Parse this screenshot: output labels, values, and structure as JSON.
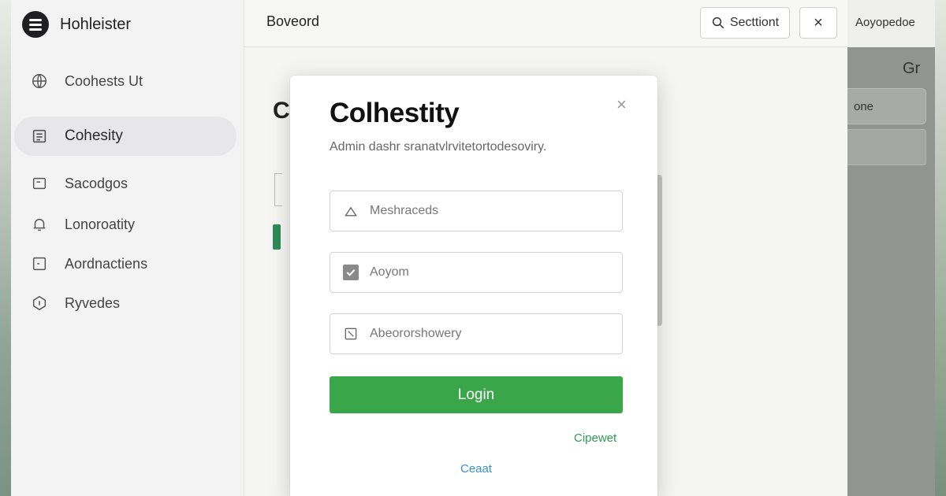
{
  "sidebar": {
    "brand": "Hohleister",
    "items": [
      {
        "label": "Coohests Ut",
        "icon": "globe-icon"
      },
      {
        "label": "Cohesity",
        "icon": "document-icon",
        "active": true
      },
      {
        "label": "Sacodgos",
        "icon": "card-icon"
      },
      {
        "label": "Lonoroatity",
        "icon": "bell-icon"
      },
      {
        "label": "Aordnactiens",
        "icon": "list-icon"
      },
      {
        "label": "Ryvedes",
        "icon": "shield-icon"
      }
    ]
  },
  "header": {
    "title": "Boveord",
    "search_label": "Secttiont",
    "close_label": "×"
  },
  "right_panel": {
    "title": "Aoyopedoe",
    "glyph": "Gr",
    "field_label": "one"
  },
  "background_page": {
    "heading_initial": "C"
  },
  "modal": {
    "title": "Colhestity",
    "subtitle": "Admin dashr sranatvlrvitetortodesoviry.",
    "close_label": "×",
    "fields": [
      {
        "placeholder": "Meshraceds",
        "icon": "user-icon"
      },
      {
        "placeholder": "Aoyom",
        "icon": "checkbox-icon"
      },
      {
        "placeholder": "Abeororshowery",
        "icon": "edit-icon"
      }
    ],
    "login_label": "Login",
    "secondary_link": "Cipewet",
    "cancel_link": "Ceaat"
  }
}
